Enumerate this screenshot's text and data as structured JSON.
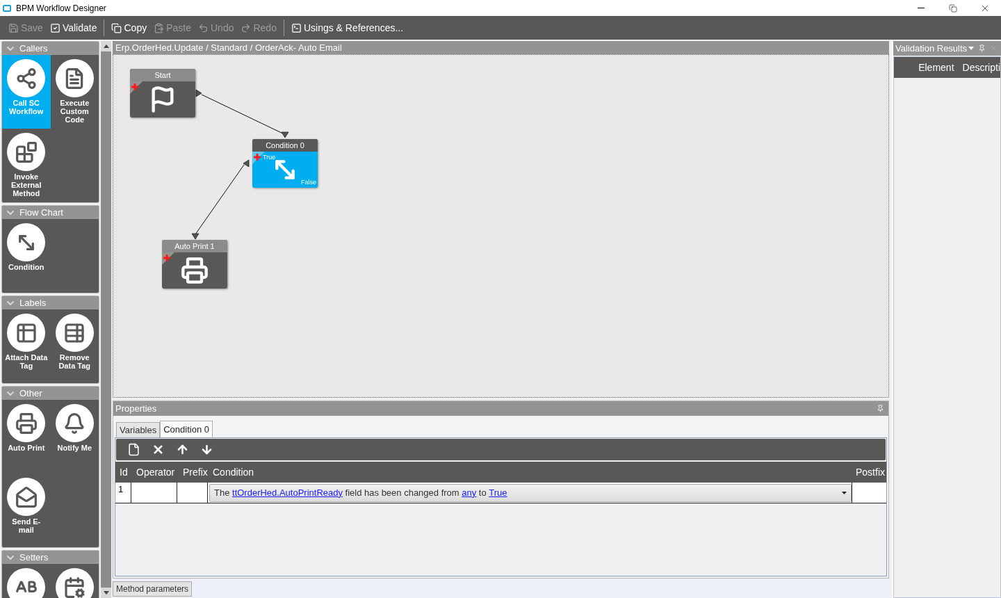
{
  "window": {
    "title": "BPM Workflow Designer"
  },
  "toolbar": [
    {
      "kind": "save",
      "label": "Save",
      "disabled": true
    },
    {
      "kind": "validate",
      "label": "Validate",
      "disabled": false
    },
    {
      "kind": "copy",
      "label": "Copy",
      "disabled": false
    },
    {
      "kind": "paste",
      "label": "Paste",
      "disabled": true
    },
    {
      "kind": "undo",
      "label": "Undo",
      "disabled": true
    },
    {
      "kind": "redo",
      "label": "Redo",
      "disabled": true
    },
    {
      "kind": "usings",
      "label": "Usings & References...",
      "disabled": false
    }
  ],
  "palette": [
    {
      "title": "Callers",
      "items": [
        {
          "kind": "call-sc",
          "label": "Call SC Workflow",
          "selected": true
        },
        {
          "kind": "custom-code",
          "label": "Execute Custom Code",
          "selected": false
        },
        {
          "kind": "invoke",
          "label": "Invoke External Method",
          "selected": false
        }
      ]
    },
    {
      "title": "Flow Chart",
      "items": [
        {
          "kind": "condition",
          "label": "Condition",
          "selected": false
        }
      ]
    },
    {
      "title": "Labels",
      "items": [
        {
          "kind": "attach-tag",
          "label": "Attach Data Tag",
          "selected": false
        },
        {
          "kind": "remove-tag",
          "label": "Remove Data Tag",
          "selected": false
        }
      ]
    },
    {
      "title": "Other",
      "items": [
        {
          "kind": "print",
          "label": "Auto Print",
          "selected": false
        },
        {
          "kind": "notify",
          "label": "Notify Me",
          "selected": false
        },
        {
          "kind": "email",
          "label": "Send E-mail",
          "selected": false
        }
      ]
    },
    {
      "title": "Setters",
      "items": [
        {
          "kind": "text-setter",
          "selected": false
        },
        {
          "kind": "date-setter",
          "selected": false
        }
      ]
    }
  ],
  "canvas": {
    "path": "Erp.OrderHed.Update / Standard / OrderAck- Auto Email",
    "nodes": [
      {
        "kind": "start",
        "title": "Start",
        "selected": false
      },
      {
        "kind": "condition",
        "title": "Condition 0",
        "selected": true,
        "true_label": "True",
        "false_label": "False"
      },
      {
        "kind": "print",
        "title": "Auto Print 1",
        "selected": false
      }
    ]
  },
  "properties": {
    "title": "Properties",
    "tabs": [
      {
        "label": "Variables",
        "selected": false
      },
      {
        "label": "Condition 0",
        "selected": true
      }
    ],
    "columns": [
      "Id",
      "Operator",
      "Prefix",
      "Condition",
      "Postfix"
    ],
    "rows": [
      {
        "id": "1",
        "condition": [
          {
            "text": "The ",
            "link": false
          },
          {
            "text": "ttOrderHed.AutoPrintReady",
            "link": true
          },
          {
            "text": " field has been changed from ",
            "link": false
          },
          {
            "text": "any",
            "link": true
          },
          {
            "text": " to ",
            "link": false
          },
          {
            "text": "True",
            "link": true
          }
        ]
      }
    ]
  },
  "bottom_tabs": [
    {
      "label": "Method parameters"
    }
  ],
  "validation": {
    "title": "Validation Results",
    "columns": [
      "Element",
      "Descripti"
    ]
  }
}
